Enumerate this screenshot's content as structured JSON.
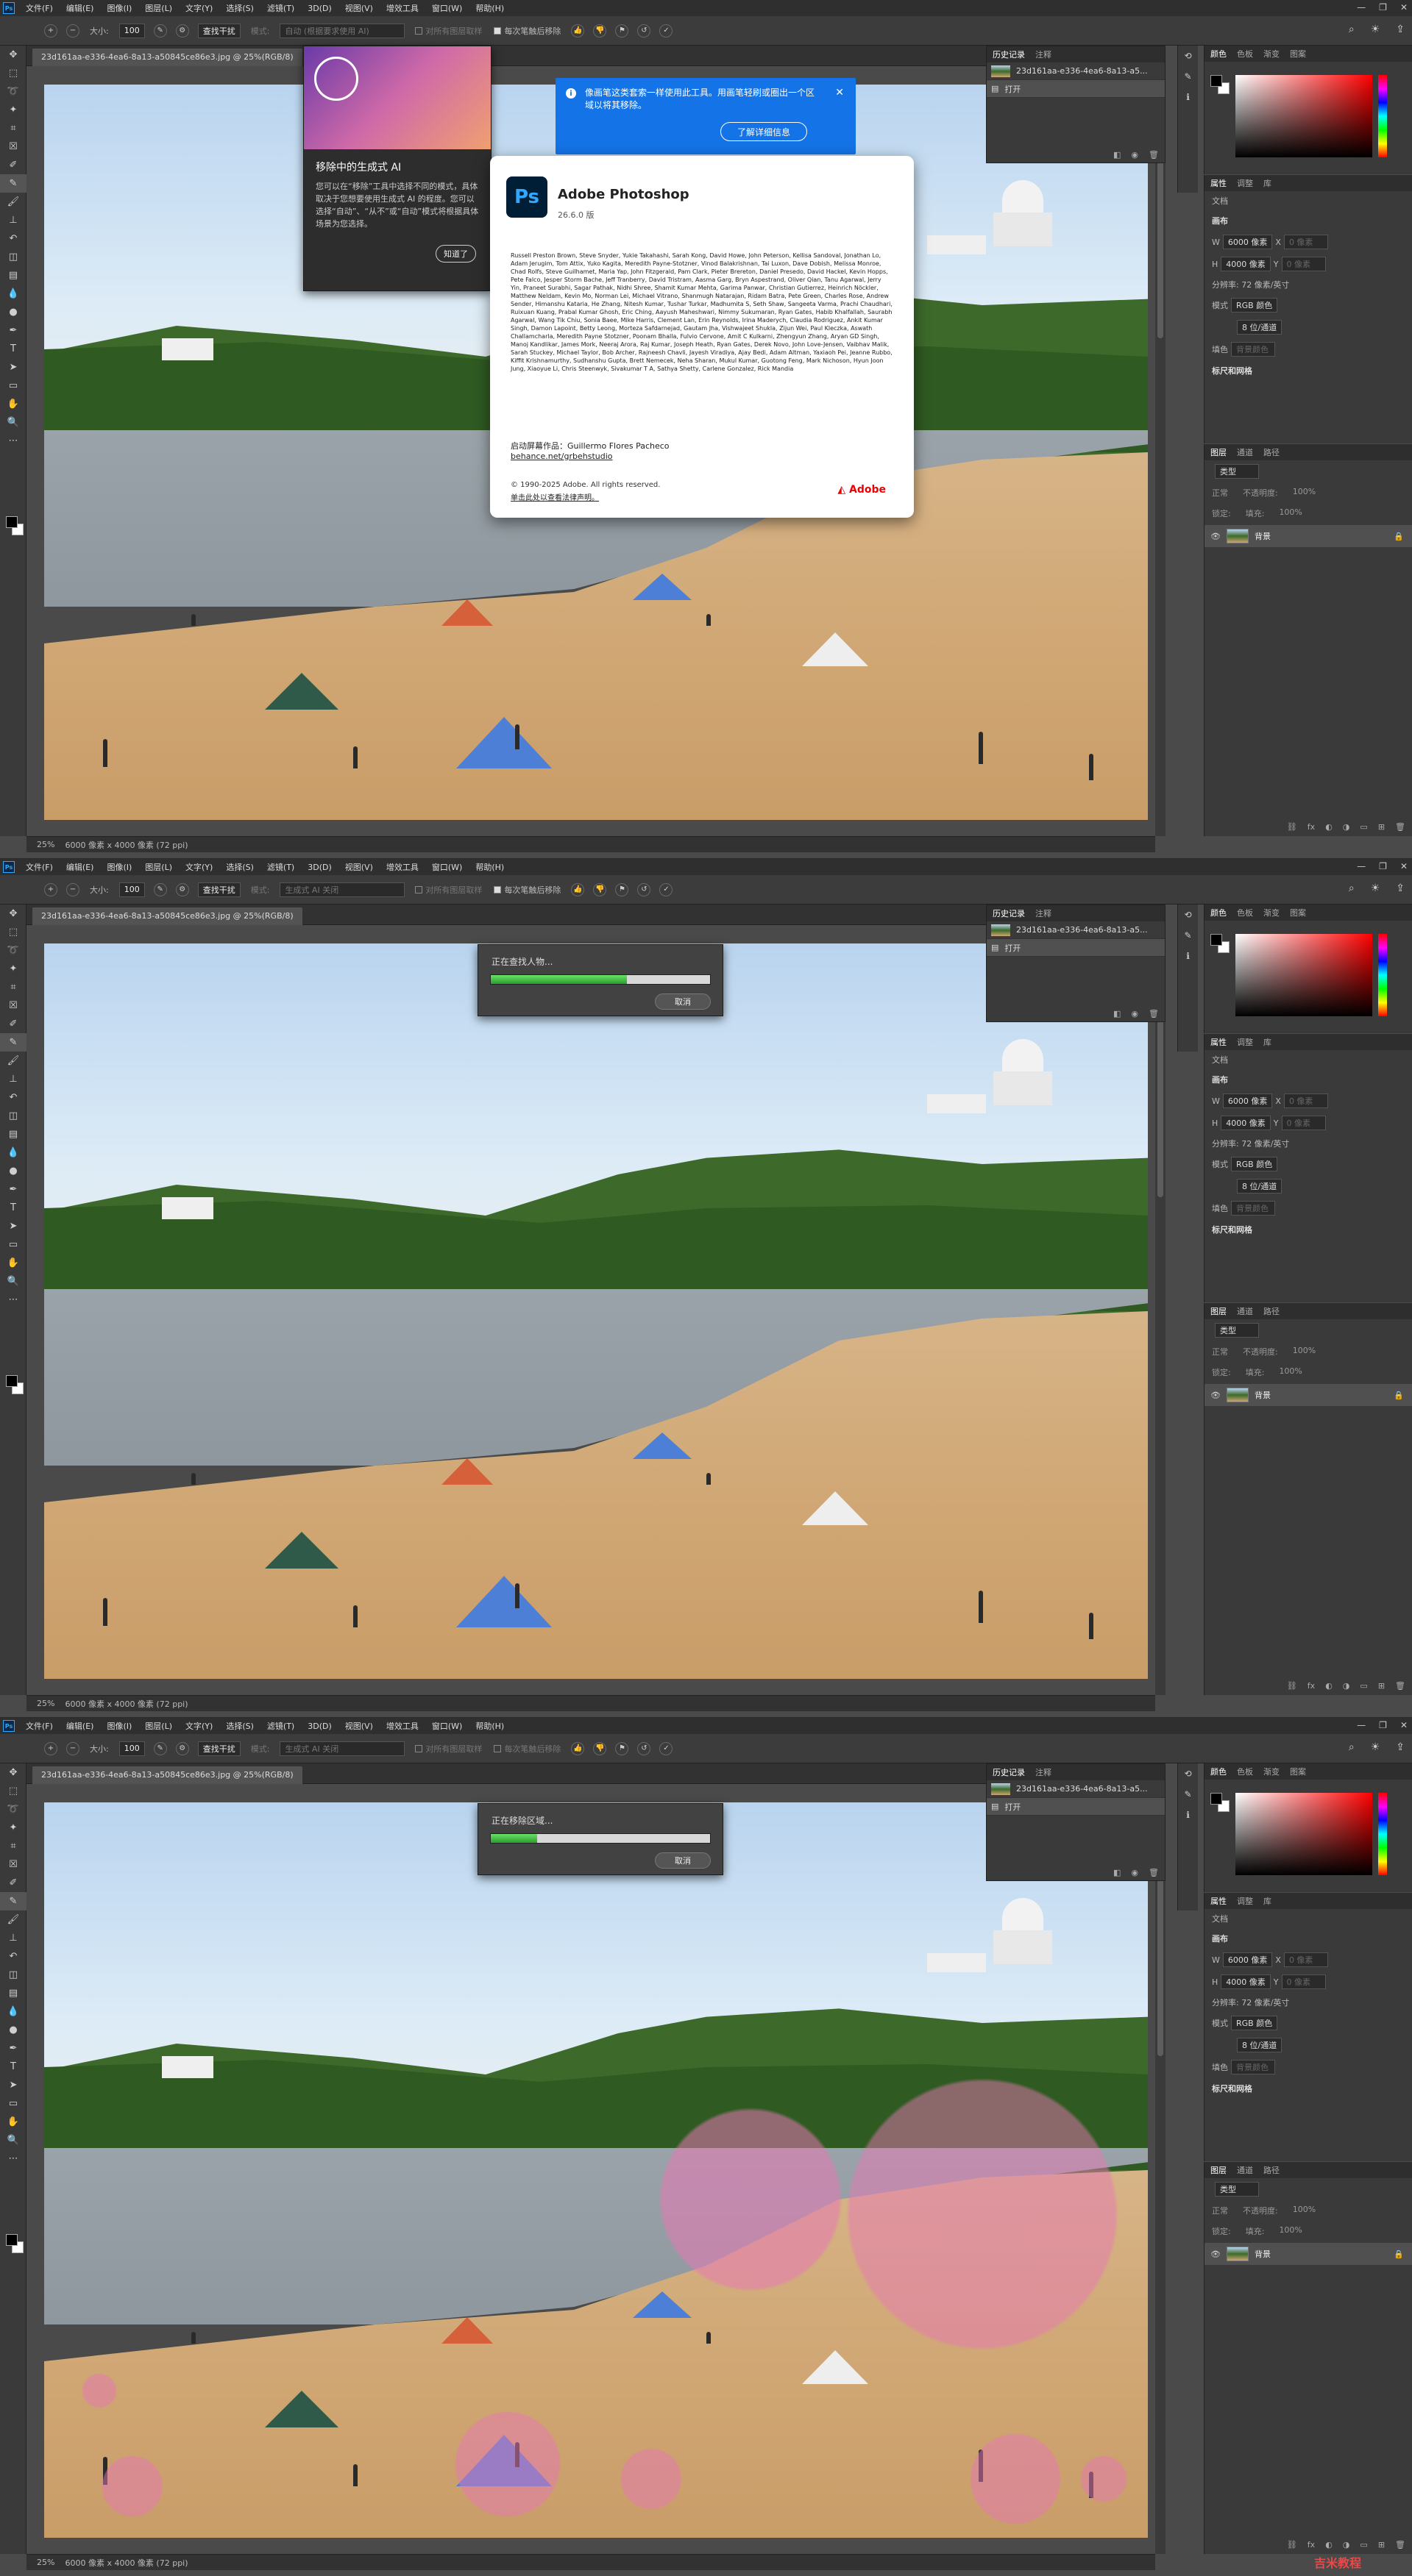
{
  "menubar": {
    "logo": "Ps",
    "items": [
      "文件(F)",
      "编辑(E)",
      "图像(I)",
      "图层(L)",
      "文字(Y)",
      "选择(S)",
      "滤镜(T)",
      "3D(D)",
      "视图(V)",
      "增效工具",
      "窗口(W)",
      "帮助(H)"
    ],
    "window_controls": [
      "—",
      "❐",
      "✕"
    ]
  },
  "options_bar": {
    "size_label": "大小:",
    "size_value": "100",
    "mode_button": "查找干扰",
    "mode_label": "模式:",
    "mode_value_1": "自动 (根据要求使用 AI)",
    "mode_value_2": "生成式 AI 关闭",
    "sample_all": "对所有图层取样",
    "remove_after": "每次笔触后移除"
  },
  "document": {
    "tab_title": "23d161aa-e336-4ea6-8a13-a50845ce86e3.jpg @ 25%(RGB/8)",
    "zoom": "25%",
    "doc_info": "6000 像素 x 4000 像素 (72 ppi)"
  },
  "history_panel": {
    "tabs": [
      "历史记录",
      "注释"
    ],
    "snapshot": "23d161aa-e336-4ea6-8a13-a5...",
    "open_step": "打开"
  },
  "color_panel": {
    "tabs": [
      "颜色",
      "色板",
      "渐变",
      "图案"
    ],
    "foreground": "#000000",
    "background": "#ffffff"
  },
  "properties_panel": {
    "tabs": [
      "属性",
      "调整",
      "库"
    ],
    "type": "文档",
    "canvas_header": "画布",
    "width_label": "W",
    "width_value": "6000 像素",
    "height_label": "H",
    "height_value": "4000 像素",
    "x_label": "X",
    "y_label": "Y",
    "x_placeholder": "0 像素",
    "y_placeholder": "0 像素",
    "resolution": "分辨率: 72 像素/英寸",
    "mode_label": "模式",
    "mode_value": "RGB 颜色",
    "depth_value": "8 位/通道",
    "fill_label": "填色",
    "fill_value": "背景颜色",
    "rulers_header": "标尺和网格"
  },
  "layers_panel": {
    "tabs": [
      "图层",
      "通道",
      "路径"
    ],
    "search_placeholder": "类型",
    "blend_mode": "正常",
    "opacity_label": "不透明度:",
    "opacity_value": "100%",
    "lock_label": "锁定:",
    "fill_label": "填充:",
    "fill_value": "100%",
    "layer_name": "背景"
  },
  "gen_ai_tip": {
    "title": "移除中的生成式 AI",
    "body": "您可以在“移除”工具中选择不同的模式，具体取决于您想要使用生成式 AI 的程度。您可以选择“自动”、“从不”或“自动”模式将根据具体场景为您选择。",
    "button": "知道了"
  },
  "notice": {
    "text": "像画笔这类套索一样使用此工具。用画笔轻刷或圈出一个区域以将其移除。",
    "button": "了解详细信息"
  },
  "about": {
    "title": "Adobe Photoshop",
    "version": "26.6.0 版",
    "credits": "Russell Preston Brown, Steve Snyder, Yukie Takahashi, Sarah Kong, David Howe, John Peterson, Kellisa Sandoval, Jonathan Lo, Adam Jerugim, Tom Attix, Yuko Kagita, Meredith Payne-Stotzner, Vinod Balakrishnan, Tai Luxon, Dave Dobish, Melissa Monroe, Chad Rolfs, Steve Guilhamet, Maria Yap, John Fitzgerald, Pam Clark, Pieter Brereton, Daniel Presedo, David Hackel, Kevin Hopps, Pete Falco, Jesper Storm Bache, Jeff Tranberry, David Tristram, Aasma Garg, Bryn Aspestrand, Oliver Qian, Tanu Agarwal, Jerry Yin, Praneet Surabhi, Sagar Pathak, Nidhi Shree, Shamit Kumar Mehta, Garima Panwar, Christian Gutierrez, Heinrich Nöckler, Matthew Neldam, Kevin Mo, Norman Lei, Michael Vitrano, Shanmugh Natarajan, Ridam Batra, Pete Green, Charles Rose, Andrew Sender, Himanshu Kataria, He Zhang, Nitesh Kumar, Tushar Turkar, Madhumita S, Seth Shaw, Sangeeta Varma, Prachi Chaudhari, Ruixuan Kuang, Prabal Kumar Ghosh, Eric Ching, Aayush Maheshwari, Nimmy Sukumaran, Ryan Gates, Habib Khalfallah, Saurabh Agarwal, Wang Tik Chiu, Sonia Baee, Mike Harris, Clement Lan, Erin Reynolds, Irina Maderych, Claudia Rodriguez, Ankit Kumar Singh, Damon Lapoint, Betty Leong, Morteza Safdarnejad, Gautam Jha, Vishwajeet Shukla, Zijun Wei, Paul Kleczka, Aswath Challamcharla, Meredith Payne Stotzner, Poonam Bhalla, Fulvio Cervone, Amit C Kulkarni, Zhengyun Zhang, Aryan GD Singh, Manoj Kandlikar, James Mork, Neeraj Arora, Raj Kumar, Joseph Heath, Ryan Gates, Derek Novo, John Love-Jensen, Vaibhav Malik, Sarah Stuckey, Michael Taylor, Bob Archer, Rajneesh Chavli, Jayesh Viradiya, Ajay Bedi, Adam Altman, Yaxiaoh Pei, Jeanne Rubbo, Kiffit Krishnamurthy, Sudhanshu Gupta, Brett Nemecek, Neha Sharan, Mukul Kumar, Guotong Feng, Mark Nichoson, Hyun Joon Jung, Xiaoyue Li, Chris Steenwyk, Sivakumar T A, Sathya Shetty, Carlene Gonzalez, Rick Mandia",
    "artwork_label": "启动屏幕作品：Guillermo Flores Pacheco",
    "artwork_link": "behance.net/grbehstudio",
    "copyright": "© 1990-2025 Adobe. All rights reserved.",
    "legal_link": "单击此处以查看法律声明。",
    "brand": "Adobe"
  },
  "progress_1": {
    "label": "正在查找人物...",
    "percent": 62,
    "cancel": "取消"
  },
  "progress_2": {
    "label": "正在移除区域...",
    "percent": 21,
    "cancel": "取消"
  },
  "watermark": "吉米教程"
}
